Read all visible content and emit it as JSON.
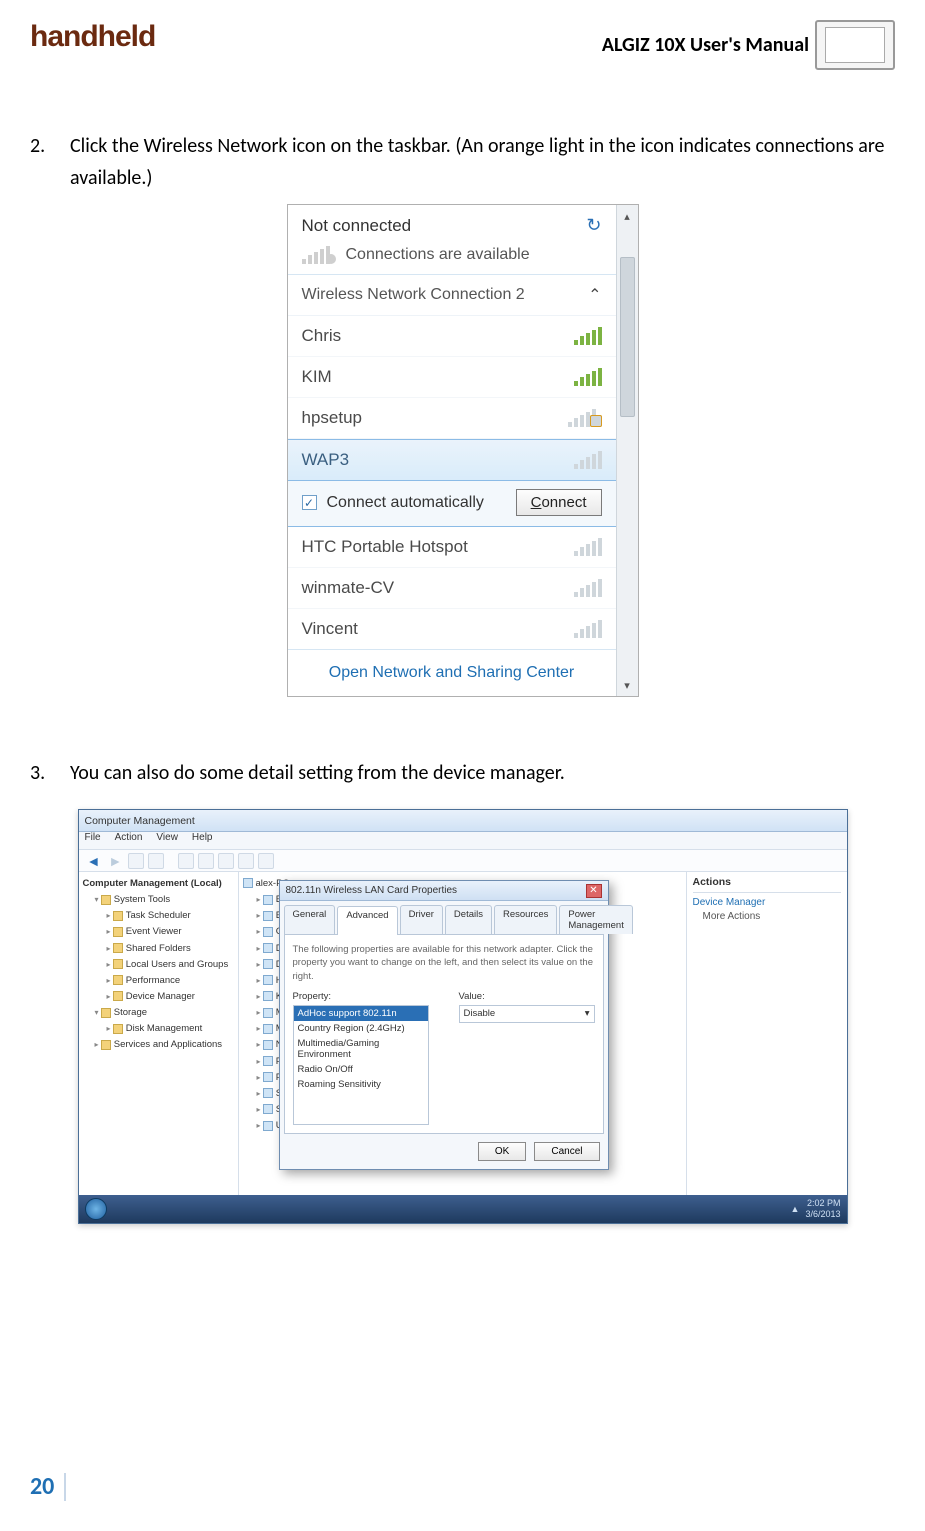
{
  "header": {
    "logo": "handheld",
    "title": "ALGIZ 10X User's Manual"
  },
  "step2": {
    "num": "2.",
    "text": "Click the Wireless Network icon on the taskbar. (An orange light in the icon indicates connections are available.)"
  },
  "wifi": {
    "status": "Not connected",
    "avail": "Connections are available",
    "header": "Wireless Network Connection 2",
    "networks": [
      "Chris",
      "KIM",
      "hpsetup",
      "WAP3",
      "HTC Portable Hotspot",
      "winmate-CV",
      "Vincent"
    ],
    "auto_label": "Connect automatically",
    "connect_btn_u": "C",
    "connect_btn_rest": "onnect",
    "footer": "Open Network and Sharing Center"
  },
  "step3": {
    "num": "3.",
    "text": "You can also do some detail setting from the device manager."
  },
  "dm": {
    "title": "Computer Management",
    "menu": [
      "File",
      "Action",
      "View",
      "Help"
    ],
    "left_root": "Computer Management (Local)",
    "left_items": [
      "System Tools",
      "Task Scheduler",
      "Event Viewer",
      "Shared Folders",
      "Local Users and Groups",
      "Performance",
      "Device Manager",
      "Storage",
      "Disk Management",
      "Services and Applications"
    ],
    "mid_root": "alex-PC",
    "mid_items": [
      "Batteries",
      "Bluetooth",
      "Computer",
      "Disk drives",
      "Display adapters",
      "Human Interface Devices",
      "Keyboards",
      "Mice",
      "Monitors",
      "Network adapters",
      "Ports",
      "Processors",
      "Sound",
      "System",
      "Universal"
    ],
    "actions_title": "Actions",
    "actions_group": "Device Manager",
    "actions_more": "More Actions"
  },
  "prop": {
    "title": "802.11n Wireless LAN Card Properties",
    "tabs": [
      "General",
      "Advanced",
      "Driver",
      "Details",
      "Resources",
      "Power Management"
    ],
    "desc": "The following properties are available for this network adapter. Click the property you want to change on the left, and then select its value on the right.",
    "property_label": "Property:",
    "value_label": "Value:",
    "list": [
      "AdHoc support 802.11n",
      "Country Region (2.4GHz)",
      "Multimedia/Gaming Environment",
      "Radio On/Off",
      "Roaming Sensitivity"
    ],
    "value": "Disable",
    "ok": "OK",
    "cancel": "Cancel"
  },
  "taskbar": {
    "time": "2:02 PM",
    "date": "3/6/2013"
  },
  "footer": {
    "page": "20"
  }
}
